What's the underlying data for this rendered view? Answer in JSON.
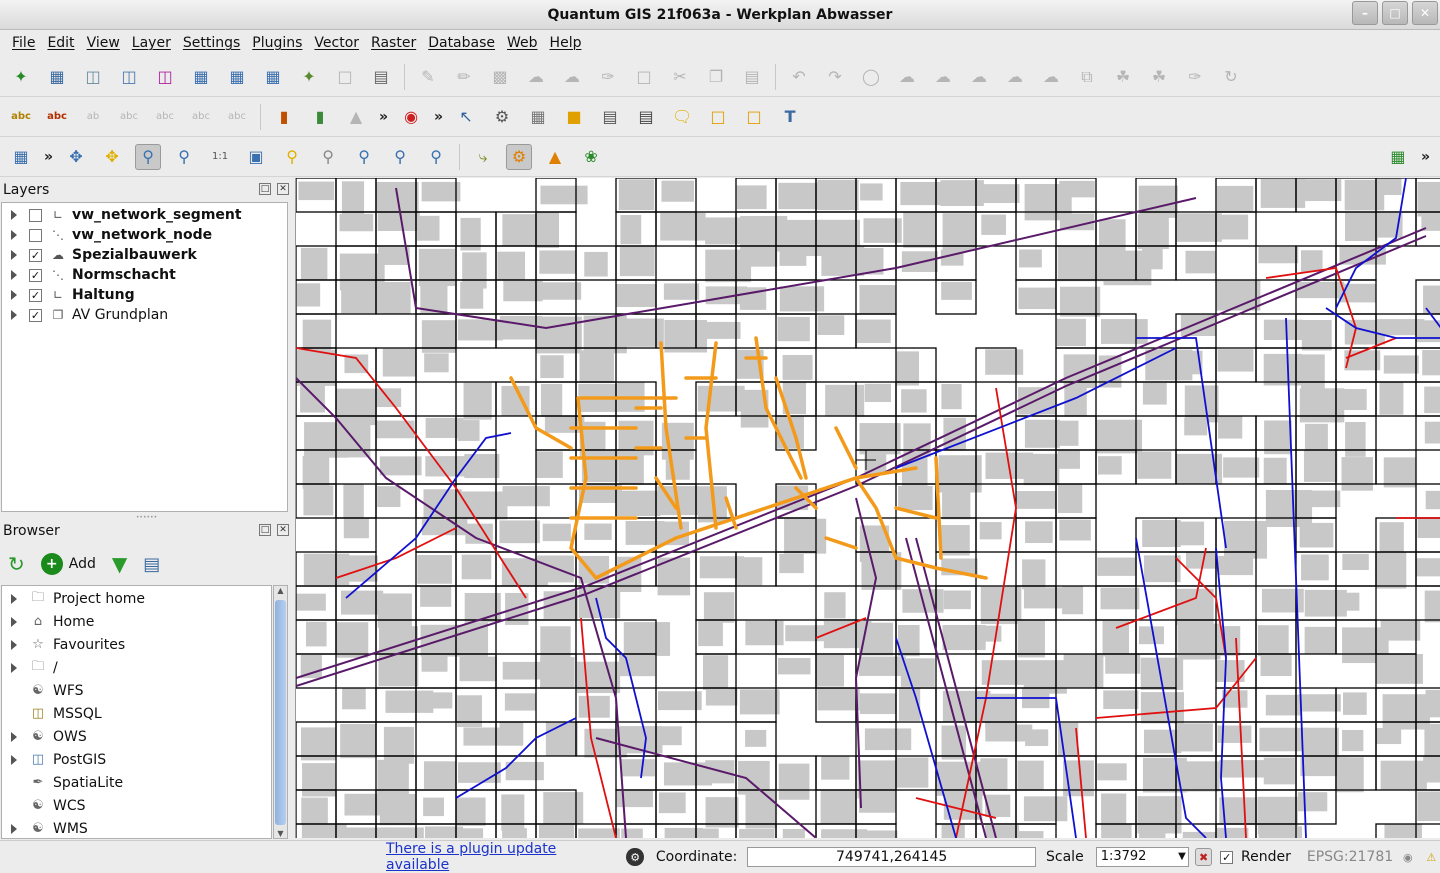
{
  "window": {
    "title": "Quantum GIS 21f063a - Werkplan Abwasser",
    "buttons": [
      "minimize",
      "maximize",
      "close"
    ]
  },
  "menu": [
    "File",
    "Edit",
    "View",
    "Layer",
    "Settings",
    "Plugins",
    "Vector",
    "Raster",
    "Database",
    "Web",
    "Help"
  ],
  "layers_panel": {
    "title": "Layers",
    "items": [
      {
        "label": "vw_network_segment",
        "checked": false,
        "bold": true,
        "icon": "line-layer-icon"
      },
      {
        "label": "vw_network_node",
        "checked": false,
        "bold": true,
        "icon": "point-layer-icon"
      },
      {
        "label": "Spezialbauwerk",
        "checked": true,
        "bold": true,
        "icon": "polygon-layer-icon"
      },
      {
        "label": "Normschacht",
        "checked": true,
        "bold": true,
        "icon": "point-layer-icon"
      },
      {
        "label": "Haltung",
        "checked": true,
        "bold": true,
        "icon": "line-layer-icon"
      },
      {
        "label": "AV Grundplan",
        "checked": true,
        "bold": false,
        "icon": "group-layer-icon"
      }
    ]
  },
  "browser_panel": {
    "title": "Browser",
    "add_label": "Add",
    "items": [
      {
        "label": "Project home",
        "expandable": true,
        "icon": "folder-icon"
      },
      {
        "label": "Home",
        "expandable": true,
        "icon": "home-folder-icon"
      },
      {
        "label": "Favourites",
        "expandable": true,
        "icon": "star-icon"
      },
      {
        "label": "/",
        "expandable": true,
        "icon": "folder-icon"
      },
      {
        "label": "WFS",
        "expandable": false,
        "icon": "wfs-icon"
      },
      {
        "label": "MSSQL",
        "expandable": false,
        "icon": "database-icon"
      },
      {
        "label": "OWS",
        "expandable": true,
        "icon": "ows-icon"
      },
      {
        "label": "PostGIS",
        "expandable": true,
        "icon": "database-icon"
      },
      {
        "label": "SpatiaLite",
        "expandable": false,
        "icon": "feather-icon"
      },
      {
        "label": "WCS",
        "expandable": false,
        "icon": "wcs-icon"
      },
      {
        "label": "WMS",
        "expandable": true,
        "icon": "wms-icon"
      }
    ]
  },
  "statusbar": {
    "plugin_update": "There is a plugin update available",
    "coordinate_label": "Coordinate:",
    "coordinate_value": "749741,264145",
    "scale_label": "Scale",
    "scale_value": "1:3792",
    "render_label": "Render",
    "render_checked": true,
    "crs": "EPSG:21781"
  },
  "colors": {
    "selected_network": "#f39a1a",
    "sewer_red": "#e01010",
    "sewer_blue": "#1010d0",
    "roads_purple": "#5a1a6a",
    "buildings_gray": "#c8c8c8"
  }
}
